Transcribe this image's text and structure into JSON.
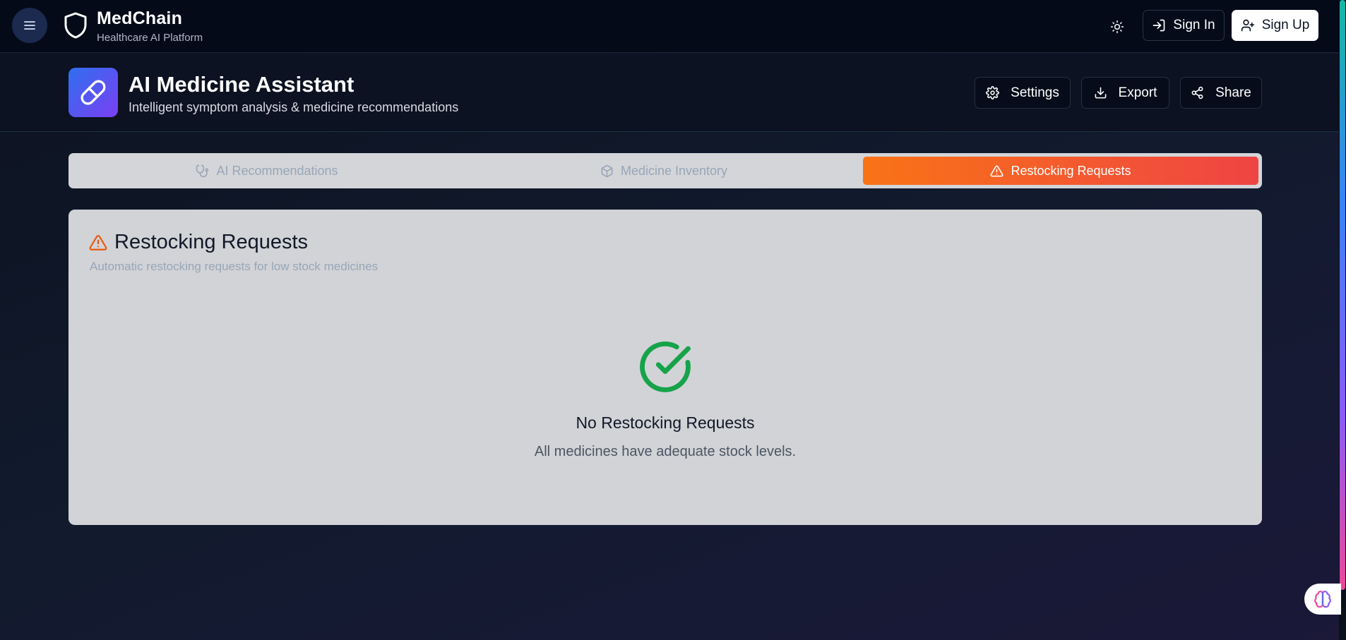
{
  "brand": {
    "name": "MedChain",
    "tagline": "Healthcare AI Platform"
  },
  "nav": {
    "signin_label": "Sign In",
    "signup_label": "Sign Up"
  },
  "header": {
    "title": "AI Medicine Assistant",
    "subtitle": "Intelligent symptom analysis & medicine recommendations",
    "settings_label": "Settings",
    "export_label": "Export",
    "share_label": "Share"
  },
  "tabs": [
    {
      "label": "AI Recommendations",
      "icon": "stethoscope-icon",
      "active": false
    },
    {
      "label": "Medicine Inventory",
      "icon": "package-icon",
      "active": false
    },
    {
      "label": "Restocking Requests",
      "icon": "alert-triangle-icon",
      "active": true
    }
  ],
  "card": {
    "title": "Restocking Requests",
    "description": "Automatic restocking requests for low stock medicines",
    "empty_title": "No Restocking Requests",
    "empty_description": "All medicines have adequate stock levels."
  },
  "icons": {
    "menu": "menu-icon",
    "logo": "shield-icon",
    "theme": "sun-icon",
    "signin": "log-in-icon",
    "signup": "user-plus-icon",
    "app": "pill-icon",
    "settings": "gear-icon",
    "export": "download-icon",
    "share": "share-icon",
    "empty": "check-circle-icon",
    "assistant": "brain-icon"
  },
  "colors": {
    "accent_start": "#f97316",
    "accent_end": "#ef4444",
    "success": "#16a34a",
    "brand_gradient_start": "#2f6ff0",
    "brand_gradient_end": "#7b3ff2"
  }
}
